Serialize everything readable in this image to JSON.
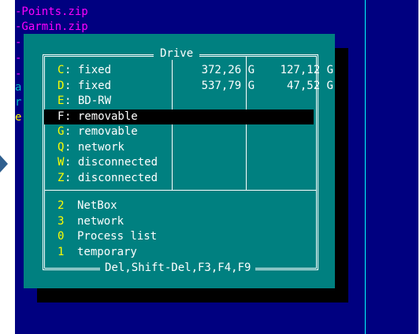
{
  "filemanager": {
    "files": [
      "-Points.zip",
      "-Garmin.zip"
    ],
    "left_marks": [
      "-",
      "-",
      "-",
      "a",
      "r",
      "e"
    ]
  },
  "dialog": {
    "title": "Drive",
    "drives": [
      {
        "letter": "C",
        "type": "fixed",
        "total": "372,26 G",
        "free": "127,12 G"
      },
      {
        "letter": "D",
        "type": "fixed",
        "total": "537,79 G",
        "free": "47,52 G"
      },
      {
        "letter": "E",
        "type": "BD-RW",
        "total": "",
        "free": ""
      },
      {
        "letter": "F",
        "type": "removable",
        "total": "",
        "free": ""
      },
      {
        "letter": "G",
        "type": "removable",
        "total": "",
        "free": ""
      },
      {
        "letter": "Q",
        "type": "network",
        "total": "",
        "free": ""
      },
      {
        "letter": "W",
        "type": "disconnected",
        "total": "",
        "free": ""
      },
      {
        "letter": "Z",
        "type": "disconnected",
        "total": "",
        "free": ""
      }
    ],
    "selected_letter": "F",
    "plugins": [
      {
        "hotkey": "2",
        "label": "NetBox"
      },
      {
        "hotkey": "3",
        "label": "network"
      },
      {
        "hotkey": "0",
        "label": "Process list"
      },
      {
        "hotkey": "1",
        "label": "temporary"
      }
    ],
    "footer": "Del,Shift-Del,F3,F4,F9"
  },
  "colors": {
    "panel_bg": "#000080",
    "dialog_bg": "#008080",
    "hotkey": "#ffff00",
    "text": "#ffffff",
    "selection_bg": "#000000",
    "filename": "#ff00ff",
    "divider": "#00ffff"
  }
}
